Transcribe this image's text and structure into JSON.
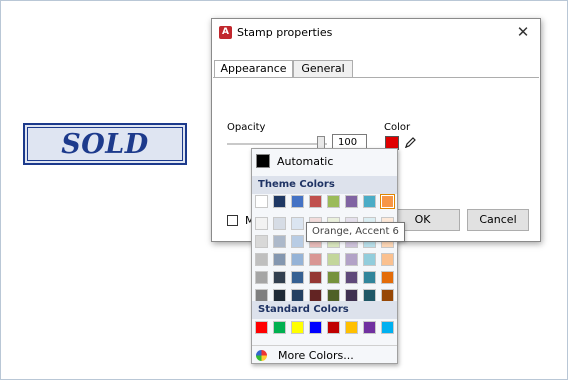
{
  "stamp": {
    "text": "SOLD"
  },
  "dialog": {
    "title": "Stamp properties",
    "close_glyph": "✕",
    "tabs": [
      {
        "label": "Appearance",
        "active": true
      },
      {
        "label": "General",
        "active": false
      }
    ],
    "opacity_label": "Opacity",
    "opacity_value": "100",
    "opacity_level": 1.0,
    "color_label": "Color",
    "current_color": "#e00000",
    "footer_checkbox_label": "M",
    "ok_label": "OK",
    "cancel_label": "Cancel"
  },
  "color_menu": {
    "automatic_label": "Automatic",
    "automatic_color": "#000000",
    "theme_heading": "Theme Colors",
    "theme_rows": [
      [
        "#ffffff",
        "#1f3864",
        "#4472c4",
        "#c0504d",
        "#9bbb59",
        "#8064a2",
        "#4bacc6",
        "#f79646"
      ],
      [
        "#f2f2f2",
        "#d6dce5",
        "#dbe5f1",
        "#f2dcdb",
        "#ebf1dd",
        "#e5e0ec",
        "#dbeef3",
        "#fde9d9"
      ],
      [
        "#d8d8d8",
        "#adb9ca",
        "#b8cce4",
        "#e5b9b7",
        "#d7e3bc",
        "#ccc1d9",
        "#b7dde8",
        "#fbd5b5"
      ],
      [
        "#bfbfbf",
        "#8497b0",
        "#95b3d7",
        "#d99694",
        "#c3d69b",
        "#b2a2c7",
        "#92cddc",
        "#fac08f"
      ],
      [
        "#a5a5a5",
        "#323f4f",
        "#366092",
        "#953734",
        "#76923c",
        "#5f497a",
        "#31859b",
        "#e36c09"
      ],
      [
        "#7f7f7f",
        "#1f2a36",
        "#244061",
        "#632423",
        "#4f6128",
        "#3f3151",
        "#205867",
        "#974806"
      ]
    ],
    "selected_theme_cell": "Orange, Accent 6",
    "standard_heading": "Standard Colors",
    "standard_colors": [
      "#ff0000",
      "#00b050",
      "#ffff00",
      "#0000ff",
      "#c00000",
      "#ffc000",
      "#7030a0",
      "#00b0f0"
    ],
    "more_label": "More Colors...",
    "tooltip": "Orange, Accent 6"
  }
}
